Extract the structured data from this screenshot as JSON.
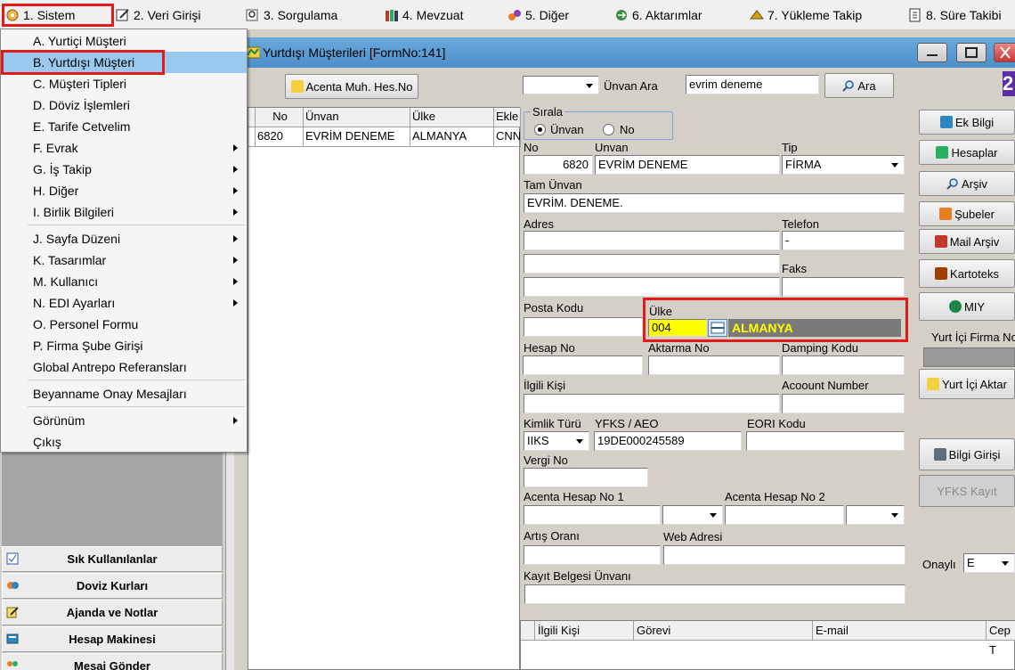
{
  "menubar": {
    "items": [
      {
        "label": "1.  Sistem",
        "icon": "system-icon"
      },
      {
        "label": "2.  Veri Girişi",
        "icon": "data-entry-icon"
      },
      {
        "label": "3.  Sorgulama",
        "icon": "query-icon"
      },
      {
        "label": "4.  Mevzuat",
        "icon": "books-icon"
      },
      {
        "label": "5.  Diğer",
        "icon": "misc-icon"
      },
      {
        "label": "6.  Aktarımlar",
        "icon": "transfer-icon"
      },
      {
        "label": "7.  Yükleme Takip",
        "icon": "loading-icon"
      },
      {
        "label": "8. Süre Takibi",
        "icon": "clock-icon"
      }
    ]
  },
  "dropdown": {
    "items": [
      {
        "label": "A.  Yurtiçi Müşteri"
      },
      {
        "label": "B.  Yurtdışı Müşteri",
        "selected": true
      },
      {
        "label": "C.  Müşteri Tipleri"
      },
      {
        "label": "D.  Döviz İşlemleri"
      },
      {
        "label": "E.  Tarife Cetvelim"
      },
      {
        "label": "F.  Evrak"
      },
      {
        "label": "G.  İş Takip"
      },
      {
        "label": "H.  Diğer"
      },
      {
        "label": "I.  Birlik Bilgileri"
      },
      {
        "label": "J.  Sayfa Düzeni"
      },
      {
        "label": "K.  Tasarımlar"
      },
      {
        "label": "M.  Kullanıcı"
      },
      {
        "label": "N.  EDI Ayarları"
      },
      {
        "label": "O.  Personel Formu"
      },
      {
        "label": "P.  Firma Şube Girişi"
      },
      {
        "label": "Global Antrepo Referansları"
      },
      {
        "label": "Beyanname Onay Mesajları"
      },
      {
        "label": "Görünüm"
      },
      {
        "label": "Çıkış"
      }
    ]
  },
  "sidebar": {
    "buttons": [
      {
        "label": "Sık Kullanılanlar"
      },
      {
        "label": "Doviz Kurları"
      },
      {
        "label": "Ajanda ve Notlar"
      },
      {
        "label": "Hesap Makinesi"
      },
      {
        "label": "Mesaj Gönder"
      }
    ]
  },
  "window": {
    "title": "Yurtdışı Müşterileri [FormNo:141]"
  },
  "toolbar": {
    "acenta_button": "Acenta Muh. Hes.No",
    "search_label": "Ünvan Ara",
    "search_value": "evrim deneme",
    "search_button": "Ara"
  },
  "grid": {
    "columns": [
      "No",
      "Ünvan",
      "Ülke",
      "Ekle"
    ],
    "rows": [
      {
        "no": "6820",
        "unvan": "EVRİM DENEME",
        "ulke": "ALMANYA",
        "ekle": "CNN"
      }
    ]
  },
  "sort": {
    "title": "Sırala",
    "option1": "Ünvan",
    "option2": "No",
    "selected": "Ünvan"
  },
  "form": {
    "no_label": "No",
    "no_value": "6820",
    "unvan_label": "Unvan",
    "unvan_value": "EVRİM DENEME",
    "tip_label": "Tip",
    "tip_value": "FİRMA",
    "tam_unvan_label": "Tam Ünvan",
    "tam_unvan_value": "EVRİM. DENEME.",
    "adres_label": "Adres",
    "telefon_label": "Telefon",
    "telefon_value": "-",
    "faks_label": "Faks",
    "posta_kodu_label": "Posta Kodu",
    "ulke_label": "Ülke",
    "ulke_code": "004",
    "ulke_name": "ALMANYA",
    "hesap_no_label": "Hesap No",
    "aktarma_no_label": "Aktarma No",
    "damping_label": "Damping Kodu",
    "ilgili_label": "İlgili Kişi",
    "account_label": "Acoount Number",
    "kimlik_label": "Kimlik Türü",
    "kimlik_value": "IIKS",
    "yfks_label": "YFKS / AEO",
    "yfks_value": "19DE000245589",
    "eori_label": "EORI Kodu",
    "vergi_label": "Vergi No",
    "acenta1_label": "Acenta Hesap No 1",
    "acenta2_label": "Acenta Hesap No 2",
    "artis_label": "Artış Oranı",
    "web_label": "Web Adresi",
    "kayit_label": "Kayıt Belgesi Ünvanı"
  },
  "right_buttons": {
    "ek_bilgi": "Ek Bilgi",
    "hesaplar": "Hesaplar",
    "arsiv": "Arşiv",
    "subeler": "Şubeler",
    "mail_arsiv": "Mail Arşiv",
    "kartoteks": "Kartoteks",
    "miy": "MIY",
    "yurt_ici_firma": "Yurt İçi Firma No",
    "yurt_ici_aktar": "Yurt İçi Aktar",
    "bilgi_girisi": "Bilgi Girişi",
    "yfks_kayit": "YFKS Kayıt",
    "onayli_label": "Onaylı",
    "onayli_value": "E"
  },
  "bottom_grid": {
    "columns": [
      "İlgili Kişi",
      "Görevi",
      "E-mail",
      "Cep T"
    ]
  },
  "colors": {
    "highlight_red": "#e21a1a",
    "menu_selected": "#99c9ef",
    "ulke_field_yellow": "#ffff00",
    "ulke_name_gray": "#7a7a7a",
    "ulke_name_text": "#ffff00",
    "titlebar_blue": "#5b9bd5"
  }
}
